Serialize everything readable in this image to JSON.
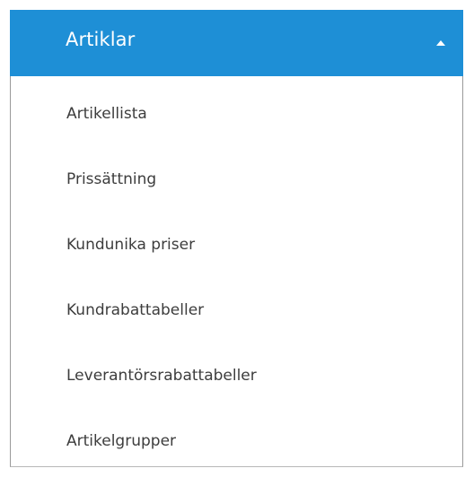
{
  "menu": {
    "title": "Artiklar",
    "header_color": "#1e8fd6",
    "expanded": true,
    "toggle_icon": "caret-up-icon",
    "items": [
      {
        "label": "Artikellista"
      },
      {
        "label": "Prissättning"
      },
      {
        "label": "Kundunika priser"
      },
      {
        "label": "Kundrabattabeller"
      },
      {
        "label": "Leverantörsrabattabeller"
      },
      {
        "label": "Artikelgrupper"
      }
    ]
  }
}
